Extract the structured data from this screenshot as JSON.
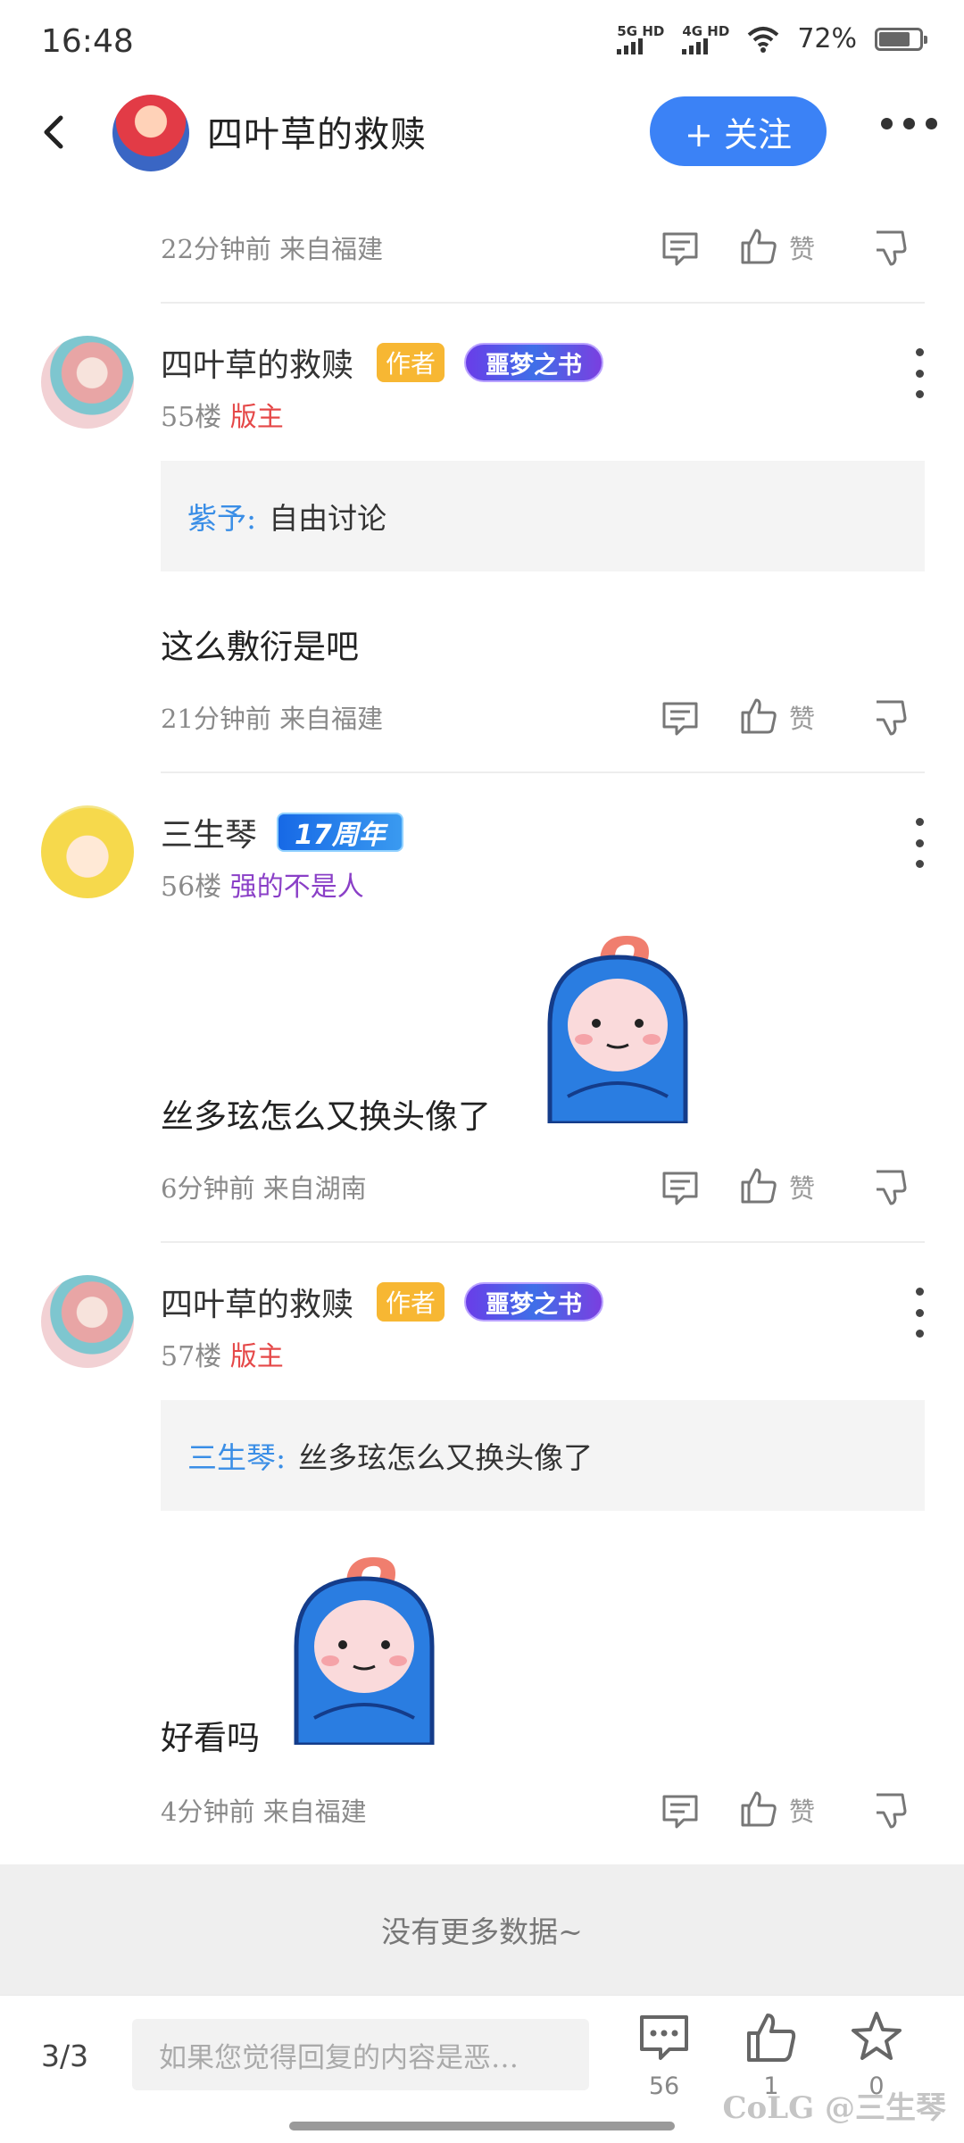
{
  "status": {
    "time": "16:48",
    "net1": "5G HD",
    "net2": "4G HD",
    "battery": "72%"
  },
  "header": {
    "title": "四叶草的救赎",
    "follow": "+ 关注"
  },
  "actions": {
    "like": "赞"
  },
  "posts": [
    {
      "meta": "22分钟前 来自福建"
    },
    {
      "user": "四叶草的救赎",
      "author_badge": "作者",
      "medal": "噩梦之书",
      "floor": "55楼",
      "title": "版主",
      "quote_name": "紫予:",
      "quote_text": "自由讨论",
      "text": "这么敷衍是吧",
      "meta": "21分钟前 来自福建"
    },
    {
      "user": "三生琴",
      "medal": "17周年",
      "floor": "56楼",
      "title": "强的不是人",
      "text": "丝多玹怎么又换头像了",
      "meta": "6分钟前 来自湖南"
    },
    {
      "user": "四叶草的救赎",
      "author_badge": "作者",
      "medal": "噩梦之书",
      "floor": "57楼",
      "title": "版主",
      "quote_name": "三生琴:",
      "quote_text": "丝多玹怎么又换头像了",
      "text": "好看吗",
      "meta": "4分钟前 来自福建"
    }
  ],
  "no_more": "没有更多数据~",
  "bottom": {
    "page": "3/3",
    "reply_placeholder": "如果您觉得回复的内容是恶…",
    "comments": "56",
    "likes": "1",
    "favs": "0"
  },
  "watermark": "CoLG @三生琴"
}
